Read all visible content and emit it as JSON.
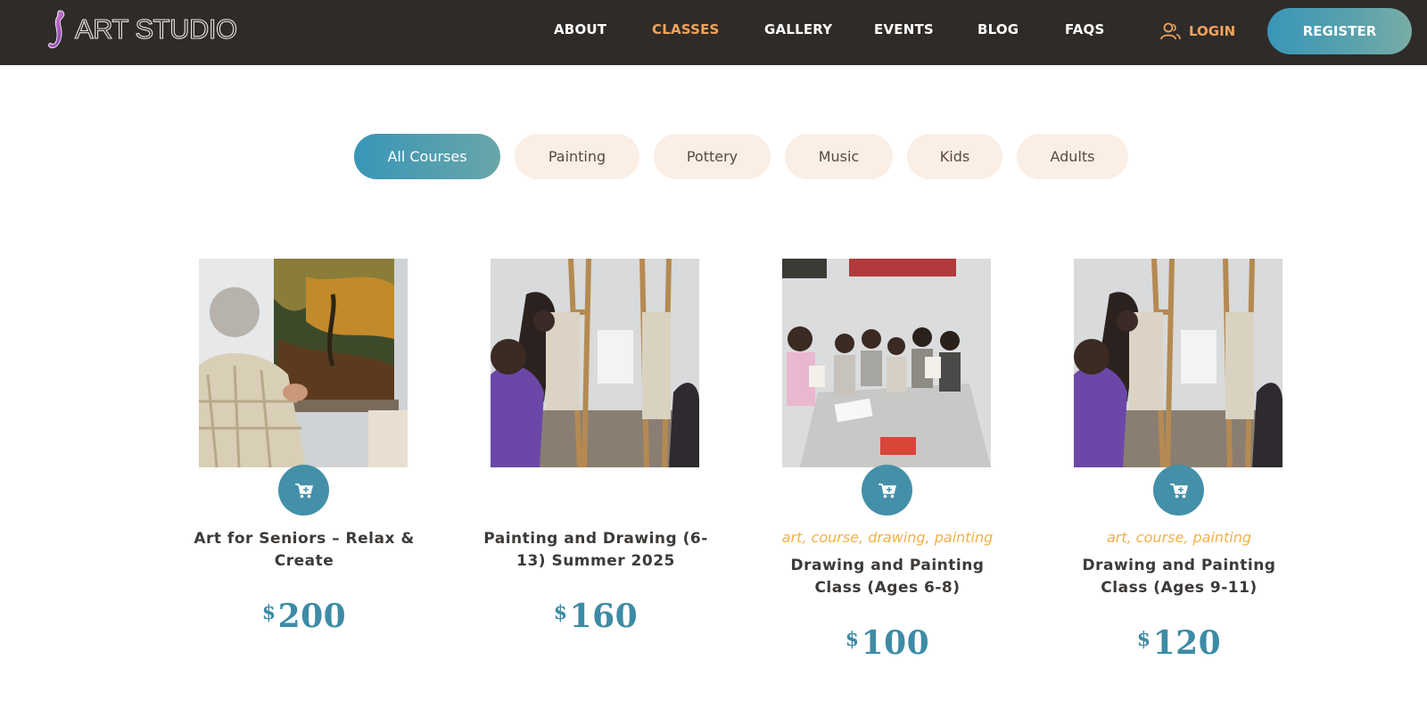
{
  "header": {
    "logo_text": "ART STUDIO",
    "nav": [
      {
        "label": "ABOUT",
        "active": false
      },
      {
        "label": "CLASSES",
        "active": true
      },
      {
        "label": "GALLERY",
        "active": false
      },
      {
        "label": "EVENTS",
        "active": false
      },
      {
        "label": "BLOG",
        "active": false
      },
      {
        "label": "FAQS",
        "active": false
      }
    ],
    "login_label": "LOGIN",
    "login_icon": "user-icon",
    "register_label": "REGISTER"
  },
  "filters": [
    {
      "label": "All Courses",
      "active": true
    },
    {
      "label": "Painting",
      "active": false
    },
    {
      "label": "Pottery",
      "active": false
    },
    {
      "label": "Music",
      "active": false
    },
    {
      "label": "Kids",
      "active": false
    },
    {
      "label": "Adults",
      "active": false
    }
  ],
  "courses": [
    {
      "title": "Art for Seniors – Relax & Create",
      "tags": "",
      "currency": "$",
      "price": "200",
      "image": "senior painting landscape at easel",
      "has_cart": true
    },
    {
      "title": "Painting and Drawing (6-13) Summer 2025",
      "tags": "",
      "currency": "$",
      "price": "160",
      "image": "children drawing at easels",
      "has_cart": false
    },
    {
      "title": "Drawing and Painting Class (Ages 6-8)",
      "tags": "art, course, drawing, painting",
      "currency": "$",
      "price": "100",
      "image": "group of kids holding drawings",
      "has_cart": true
    },
    {
      "title": "Drawing and Painting Class (Ages 9-11)",
      "tags": "art, course, painting",
      "currency": "$",
      "price": "120",
      "image": "children drawing at easels",
      "has_cart": true
    }
  ],
  "colors": {
    "header_bg": "#2f2b28",
    "accent_orange": "#f2a35c",
    "accent_teal": "#3996b7",
    "pill_bg": "#fbeee4",
    "price": "#3d8ba6",
    "tags": "#f0b14a"
  }
}
